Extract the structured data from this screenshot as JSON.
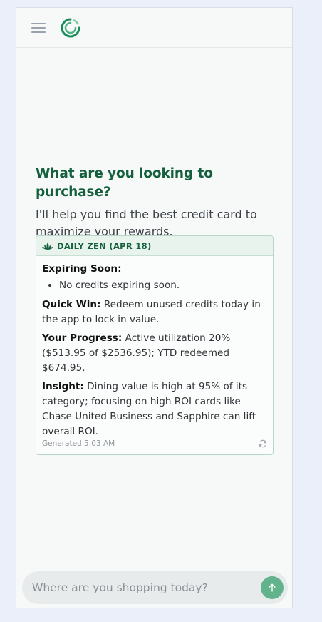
{
  "header": {
    "menu_icon": "hamburger-menu-icon",
    "logo_icon": "circular-swirl-logo",
    "brand_color": "#1b8a5a"
  },
  "hero": {
    "title": "What are you looking to purchase?",
    "subtitle": "I'll help you find the best credit card to maximize your rewards."
  },
  "daily_card": {
    "icon": "lotus-icon",
    "heading": "DAILY ZEN (APR 18)",
    "expiring_label": "Expiring Soon:",
    "expiring_items": [
      "No credits expiring soon."
    ],
    "quick_win_label": "Quick Win:",
    "quick_win_text": " Redeem unused credits today in the app to lock in value.",
    "progress_label": "Your Progress:",
    "progress_text": " Active utilization 20% ($513.95 of $2536.95); YTD redeemed $674.95.",
    "insight_label": "Insight:",
    "insight_text": " Dining value is high at 95% of its category; focusing on high ROI cards like Chase United Business and Sapphire can lift overall ROI.",
    "generated": "Generated 5:03 AM",
    "refresh_icon": "refresh-icon"
  },
  "composer": {
    "placeholder": "Where are you shopping today?",
    "value": "",
    "send_icon": "arrow-up-icon",
    "send_color": "#62b38c"
  }
}
